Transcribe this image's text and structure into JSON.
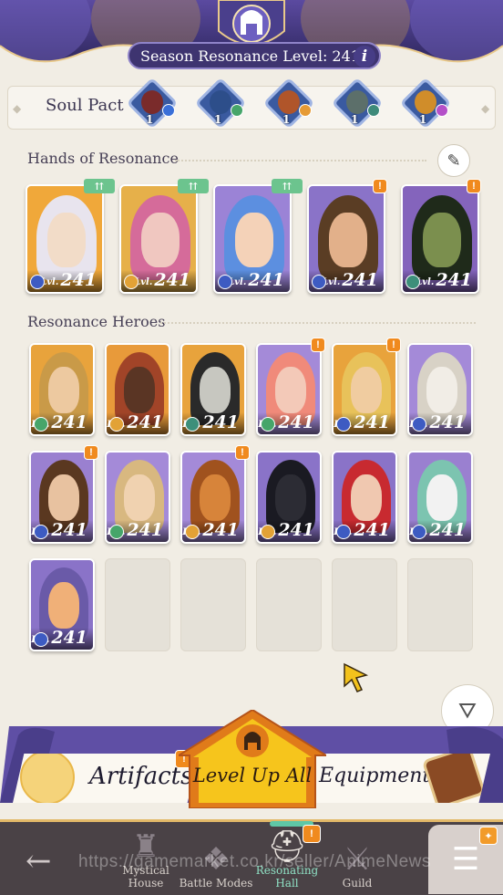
{
  "header": {
    "season_label": "Season Resonance Level: 241",
    "info_glyph": "i",
    "emblem_icon": "spartan-helmet-icon"
  },
  "soul_pact": {
    "label": "Soul Pact",
    "slots": [
      {
        "level": "1",
        "face": "#7a2b2b",
        "badge_color": "#3a6fd8",
        "icon": "masked-warrior-icon"
      },
      {
        "level": "1",
        "face": "#2d4e8a",
        "badge_color": "#46a56a",
        "icon": "crystal-creature-icon"
      },
      {
        "level": "1",
        "face": "#b0552a",
        "badge_color": "#e69a35",
        "icon": "flame-beast-icon"
      },
      {
        "level": "1",
        "face": "#5c6f6a",
        "badge_color": "#3e8a7a",
        "icon": "alien-face-icon"
      },
      {
        "level": "1",
        "face": "#d08d2a",
        "badge_color": "#b44fc8",
        "icon": "golden-idol-icon"
      }
    ]
  },
  "hands_of_resonance": {
    "title": "Hands of Resonance",
    "edit_icon": "quill-icon",
    "heroes": [
      {
        "level": "241",
        "lvl_prefix": "Lvl.",
        "bg": "#f0a83a",
        "skin": "#f2dcc8",
        "hair": "#e8e4ee",
        "class_color": "#3d5bc2",
        "tag": "up"
      },
      {
        "level": "241",
        "lvl_prefix": "Lvl.",
        "bg": "#e6b04a",
        "skin": "#f0c7c0",
        "hair": "#d56b9a",
        "class_color": "#e2a236",
        "tag": "up"
      },
      {
        "level": "241",
        "lvl_prefix": "Lvl.",
        "bg": "#9b83d6",
        "skin": "#f4d2b8",
        "hair": "#5c8fe0",
        "class_color": "#3d5bc2",
        "tag": "up"
      },
      {
        "level": "241",
        "lvl_prefix": "Lvl.",
        "bg": "#8a73c8",
        "skin": "#e2b08a",
        "hair": "#5a3d24",
        "class_color": "#3d5bc2",
        "tag": "alert"
      },
      {
        "level": "241",
        "lvl_prefix": "Lvl.",
        "bg": "#8464bc",
        "skin": "#7b8f4e",
        "hair": "#1f2a1a",
        "class_color": "#3d8f7a",
        "tag": "alert"
      }
    ],
    "up_glyph": "⇈",
    "alert_glyph": "!"
  },
  "resonance_heroes": {
    "title": "Resonance Heroes",
    "heroes": [
      {
        "level": "241",
        "bg": "#e8a33c",
        "skin": "#edc9a0",
        "hair": "#c99a48",
        "class_color": "#46a56a",
        "alert": false
      },
      {
        "level": "241",
        "bg": "#e89a3a",
        "skin": "#5a3524",
        "hair": "#a14428",
        "class_color": "#e2a236",
        "alert": false
      },
      {
        "level": "241",
        "bg": "#e8a33c",
        "skin": "#c7c7c0",
        "hair": "#2a2a2a",
        "class_color": "#3d8f7a",
        "alert": false
      },
      {
        "level": "241",
        "bg": "#a48ad8",
        "skin": "#f3c9b8",
        "hair": "#f08a7a",
        "class_color": "#46a56a",
        "alert": true
      },
      {
        "level": "241",
        "bg": "#e8a33c",
        "skin": "#f0cca0",
        "hair": "#e8c25a",
        "class_color": "#3d5bc2",
        "alert": true
      },
      {
        "level": "241",
        "bg": "#a48ad8",
        "skin": "#f1ede6",
        "hair": "#d8d2c6",
        "class_color": "#3d5bc2",
        "alert": false
      },
      {
        "level": "241",
        "bg": "#9a80d0",
        "skin": "#e8c2a0",
        "hair": "#5a3820",
        "class_color": "#3d5bc2",
        "alert": true
      },
      {
        "level": "241",
        "bg": "#a48ad8",
        "skin": "#f0d2b0",
        "hair": "#d8b880",
        "class_color": "#46a56a",
        "alert": false
      },
      {
        "level": "241",
        "bg": "#a48ad8",
        "skin": "#d7843a",
        "hair": "#a0521e",
        "class_color": "#e2a236",
        "alert": true
      },
      {
        "level": "241",
        "bg": "#8a73c8",
        "skin": "#2c2c34",
        "hair": "#1a1a22",
        "class_color": "#e2a236",
        "alert": false
      },
      {
        "level": "241",
        "bg": "#8a73c8",
        "skin": "#f0c8b0",
        "hair": "#c82a30",
        "class_color": "#3d5bc2",
        "alert": false
      },
      {
        "level": "241",
        "bg": "#9a80d0",
        "skin": "#f2f2f2",
        "hair": "#7cc4b0",
        "class_color": "#3d5bc2",
        "alert": false
      },
      {
        "level": "241",
        "bg": "#8a73c8",
        "skin": "#f0b078",
        "hair": "#6a5aa8",
        "class_color": "#3d5bc2",
        "alert": false
      }
    ],
    "lvl_prefix": "Lvl.",
    "alert_glyph": "!",
    "empty_slots": 5
  },
  "filter_button": {
    "icon": "filter-sort-icon",
    "glyph": "⛛"
  },
  "actions": {
    "artifacts_label": "Artifacts",
    "level_up_label": "Level Up All",
    "equipment_label": "Equipment",
    "alert_glyph": "!"
  },
  "bottom_nav": {
    "back_glyph": "←",
    "items": [
      {
        "label": "Mystical House",
        "line1": "Mystical",
        "line2": "House",
        "icon": "tower-icon",
        "glyph": "♜"
      },
      {
        "label": "Battle Modes",
        "line1": "Battle Modes",
        "line2": "",
        "icon": "crossed-swords-icon",
        "glyph": "❖"
      },
      {
        "label": "Resonating Hall",
        "line1": "Resonating",
        "line2": "Hall",
        "icon": "helmet-icon",
        "glyph": "⛑"
      },
      {
        "label": "Guild",
        "line1": "Guild",
        "line2": "",
        "icon": "guild-sword-icon",
        "glyph": "⚔"
      }
    ],
    "menu_glyph": "☰",
    "gift_glyph": "✦"
  },
  "watermark": "https://gamemarket.co.kr/seller/AnimeNews",
  "colors": {
    "accent_purple": "#3e3470",
    "accent_orange": "#f08a1e",
    "gold": "#f3b51c",
    "up_green": "#6cc48e"
  }
}
